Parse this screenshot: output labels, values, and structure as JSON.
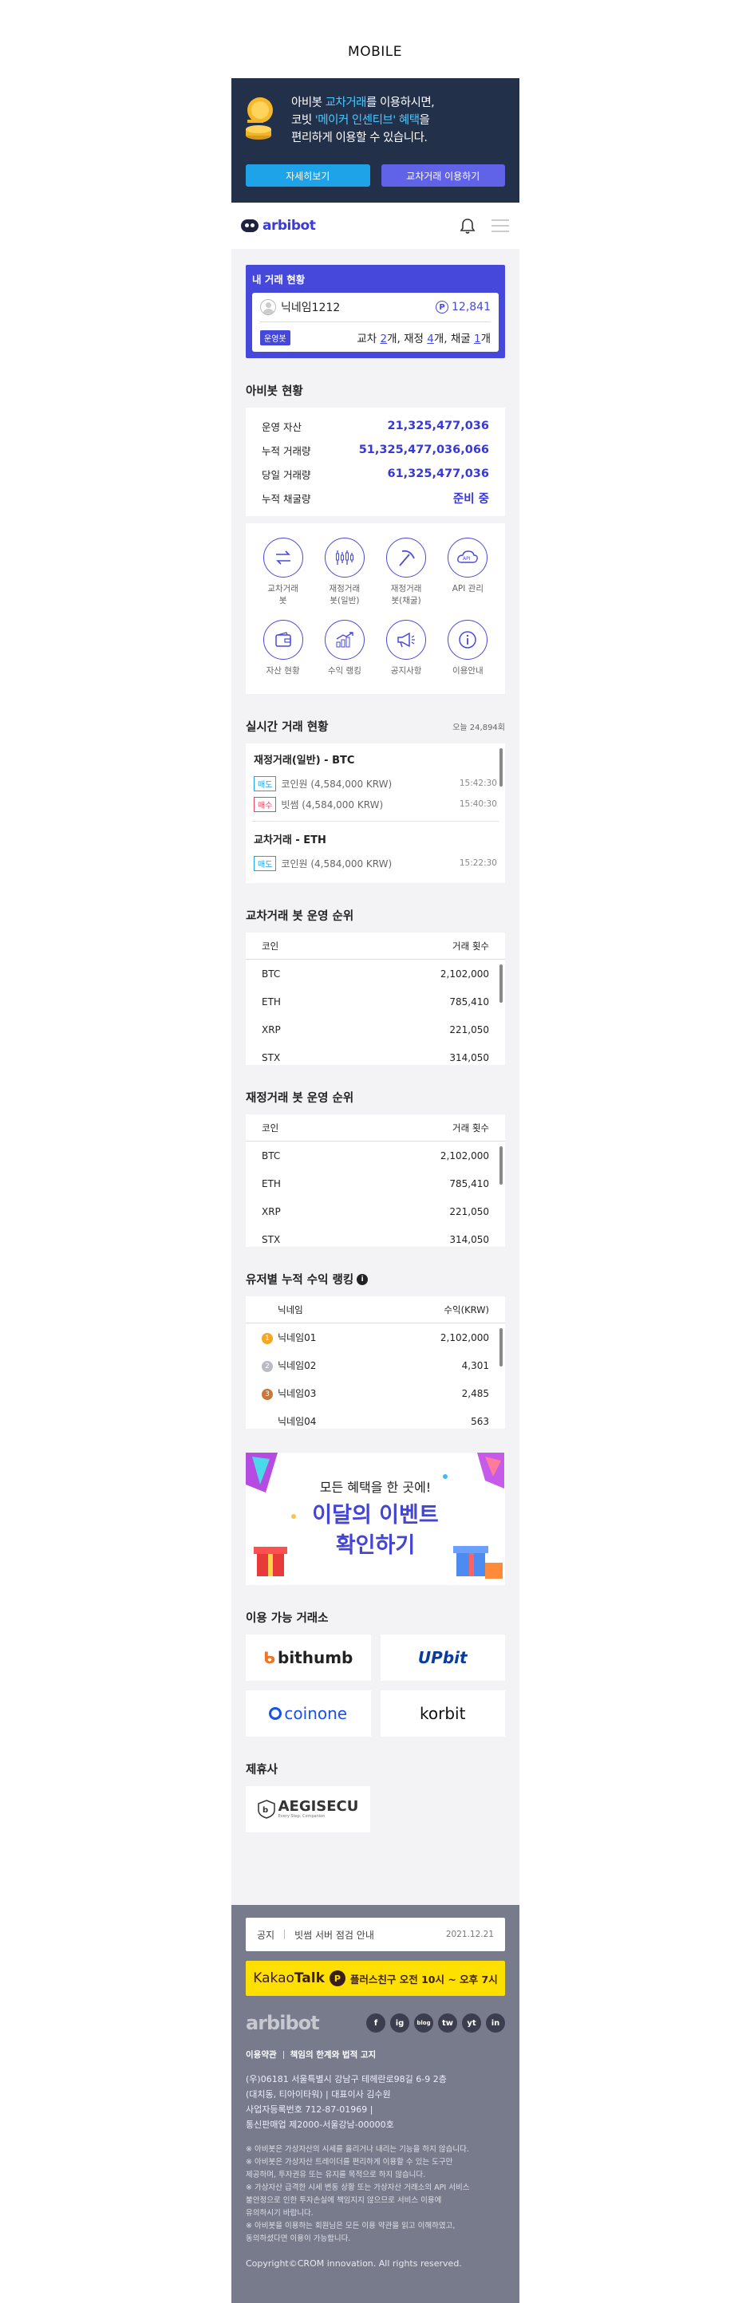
{
  "page_label": "MOBILE",
  "banner": {
    "line1_pre": "아비봇 ",
    "line1_hl": "교차거래",
    "line1_post": "를 이용하시면,",
    "line2_pre": "코빗 ",
    "line2_hl": "'메이커 인센티브' 혜택",
    "line2_post": "을",
    "line3": "편리하게 이용할 수 있습니다.",
    "btn_detail": "자세히보기",
    "btn_use": "교차거래 이용하기"
  },
  "header": {
    "logo": "arbibot"
  },
  "my_trade": {
    "title": "내 거래 현황",
    "nickname": "닉네임1212",
    "points": "12,841",
    "badge": "운영봇",
    "count_pre1": "교차 ",
    "count_cross": "2",
    "count_mid1": "개, 재정 ",
    "count_arb": "4",
    "count_mid2": "개, 채굴 ",
    "count_mine": "1",
    "count_post": "개"
  },
  "status": {
    "title": "아비봇 현황",
    "rows": [
      {
        "label": "운영 자산",
        "value": "21,325,477,036"
      },
      {
        "label": "누적 거래량",
        "value": "51,325,477,036,066"
      },
      {
        "label": "당일 거래량",
        "value": "61,325,477,036"
      },
      {
        "label": "누적 채굴량",
        "value": "준비 중"
      }
    ]
  },
  "menu": [
    {
      "label": "교차거래\n봇",
      "icon": "exchange-icon"
    },
    {
      "label": "재정거래\n봇(일반)",
      "icon": "candlestick-icon"
    },
    {
      "label": "재정거래\n봇(채굴)",
      "icon": "pickaxe-icon"
    },
    {
      "label": "API 관리",
      "icon": "api-icon"
    },
    {
      "label": "자산 현황",
      "icon": "wallet-icon"
    },
    {
      "label": "수익 랭킹",
      "icon": "growth-chart-icon"
    },
    {
      "label": "공지사항",
      "icon": "megaphone-icon"
    },
    {
      "label": "이용안내",
      "icon": "info-icon"
    }
  ],
  "realtime": {
    "title": "실시간 거래 현황",
    "today": "오늘 24,894회",
    "blocks": [
      {
        "title": "재정거래(일반) - BTC",
        "lines": [
          {
            "tag": "매도",
            "type": "sell",
            "text": "코인원 (4,584,000 KRW)",
            "time": "15:42:30"
          },
          {
            "tag": "매수",
            "type": "buy",
            "text": "빗썸 (4,584,000 KRW)",
            "time": "15:40:30"
          }
        ]
      },
      {
        "title": "교차거래 - ETH",
        "lines": [
          {
            "tag": "매도",
            "type": "sell",
            "text": "코인원 (4,584,000 KRW)",
            "time": "15:22:30"
          }
        ]
      }
    ]
  },
  "cross_rank": {
    "title": "교차거래 봇 운영 순위",
    "col1": "코인",
    "col2": "거래 횟수",
    "rows": [
      {
        "coin": "BTC",
        "count": "2,102,000"
      },
      {
        "coin": "ETH",
        "count": "785,410"
      },
      {
        "coin": "XRP",
        "count": "221,050"
      },
      {
        "coin": "STX",
        "count": "314,050"
      }
    ]
  },
  "arb_rank": {
    "title": "재정거래 봇 운영 순위",
    "col1": "코인",
    "col2": "거래 횟수",
    "rows": [
      {
        "coin": "BTC",
        "count": "2,102,000"
      },
      {
        "coin": "ETH",
        "count": "785,410"
      },
      {
        "coin": "XRP",
        "count": "221,050"
      },
      {
        "coin": "STX",
        "count": "314,050"
      }
    ]
  },
  "user_rank": {
    "title": "유저별 누적 수익 랭킹",
    "col1": "닉네임",
    "col2": "수익(KRW)",
    "rows": [
      {
        "name": "닉네임01",
        "value": "2,102,000",
        "medal": "#f5a623"
      },
      {
        "name": "닉네임02",
        "value": "4,301",
        "medal": "#b9bcc4"
      },
      {
        "name": "닉네임03",
        "value": "2,485",
        "medal": "#c9773a"
      },
      {
        "name": "닉네임04",
        "value": "563",
        "medal": ""
      }
    ]
  },
  "event": {
    "small": "모든 혜택을 한 곳에!",
    "big1": "이달의 이벤트",
    "big2": "확인하기"
  },
  "exchanges": {
    "title": "이용 가능 거래소",
    "items": [
      {
        "name": "bithumb",
        "color": "#222222"
      },
      {
        "name": "UPbit",
        "color": "#0a3c9e"
      },
      {
        "name": "coinone",
        "color": "#1552f0"
      },
      {
        "name": "korbit",
        "color": "#111111"
      }
    ]
  },
  "partners": {
    "title": "제휴사",
    "name": "AEGISECU",
    "tagline": "Every Step, Companion"
  },
  "footer": {
    "notice_label": "공지",
    "notice_text": "빗썸 서버 점검 안내",
    "notice_date": "2021.12.21",
    "kakao_word1": "Kakao",
    "kakao_word2": "Talk",
    "kakao_text": "플러스친구  오전 10시 ~ 오후 7시",
    "logo": "arbibot",
    "social": [
      "f",
      "ig",
      "blog",
      "tw",
      "yt",
      "in"
    ],
    "policy1": "이용약관",
    "policy2": "책임의 한계와 법적 고지",
    "company": [
      "(우)06181 서울특별시 강남구 테헤란로98길 6-9 2층",
      "(대치동, 티아이타워)  |  대표이사 김수원",
      "사업자등록번호 712-87-01969  |",
      "통신판매업 제2000-서울강남-00000호"
    ],
    "disclaimer": [
      "※ 아비봇은 가상자산의 시세를 올리거나 내리는 기능을 하지 않습니다.",
      "※ 아비봇은 가상자산 트레이더를 편리하게 이용할 수 있는 도구만",
      "제공하며, 투자권유 또는 유지를 목적으로 하지 않습니다.",
      "※ 가상자산 급격한 시세 변동 상황 또는 가상자산 거래소의 API 서비스",
      "불안정으로 인한 투자손실에 책임지지 않으므로 서비스 이용에",
      "유의하시기 바랍니다.",
      "※ 아비봇을 이용하는 회원님은 모든 이용 약관을 읽고 이해하였고,",
      "동의하셨다면 이용이 가능합니다."
    ],
    "copyright": "Copyright©CROM innovation. All rights reserved."
  }
}
